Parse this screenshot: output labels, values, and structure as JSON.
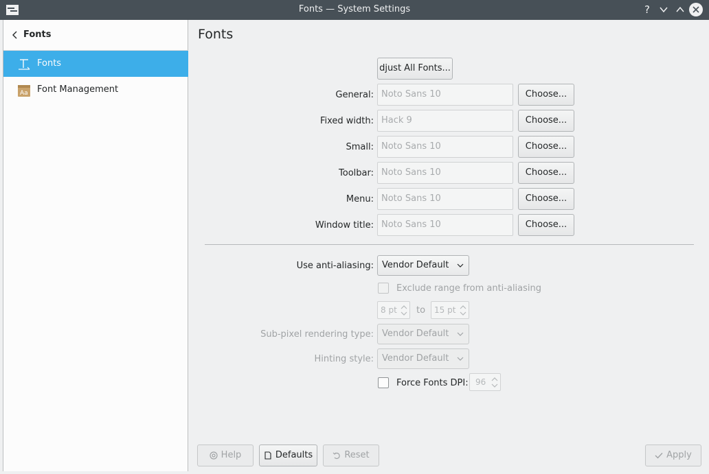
{
  "window": {
    "title": "Fonts — System Settings",
    "help_glyph": "?"
  },
  "sidebar": {
    "back_label": "Fonts",
    "items": [
      {
        "label": "Fonts",
        "icon": "fonts-icon",
        "active": true
      },
      {
        "label": "Font Management",
        "icon": "font-management-icon",
        "active": false
      }
    ]
  },
  "main": {
    "title": "Fonts",
    "adjust_all_label": "djust All Fonts...",
    "rows": [
      {
        "label": "General:",
        "value": "Noto Sans 10",
        "button": "Choose..."
      },
      {
        "label": "Fixed width:",
        "value": "Hack  9",
        "button": "Choose..."
      },
      {
        "label": "Small:",
        "value": "Noto Sans 10",
        "button": "Choose..."
      },
      {
        "label": "Toolbar:",
        "value": "Noto Sans 10",
        "button": "Choose..."
      },
      {
        "label": "Menu:",
        "value": "Noto Sans 10",
        "button": "Choose..."
      },
      {
        "label": "Window title:",
        "value": "Noto Sans 10",
        "button": "Choose..."
      }
    ],
    "antialias": {
      "label": "Use anti-aliasing:",
      "value": "Vendor Default"
    },
    "exclude": {
      "label": "Exclude range from anti-aliasing",
      "from": "8 pt",
      "to_label": "to",
      "to": "15 pt"
    },
    "subpixel": {
      "label": "Sub-pixel rendering type:",
      "value": "Vendor Default"
    },
    "hinting": {
      "label": "Hinting style:",
      "value": "Vendor Default"
    },
    "dpi": {
      "label": "Force Fonts DPI:",
      "value": "96"
    }
  },
  "footer": {
    "help": "Help",
    "defaults": "Defaults",
    "reset": "Reset",
    "apply": "Apply"
  },
  "colors": {
    "accent": "#3daee9",
    "titlebar": "#475057"
  }
}
